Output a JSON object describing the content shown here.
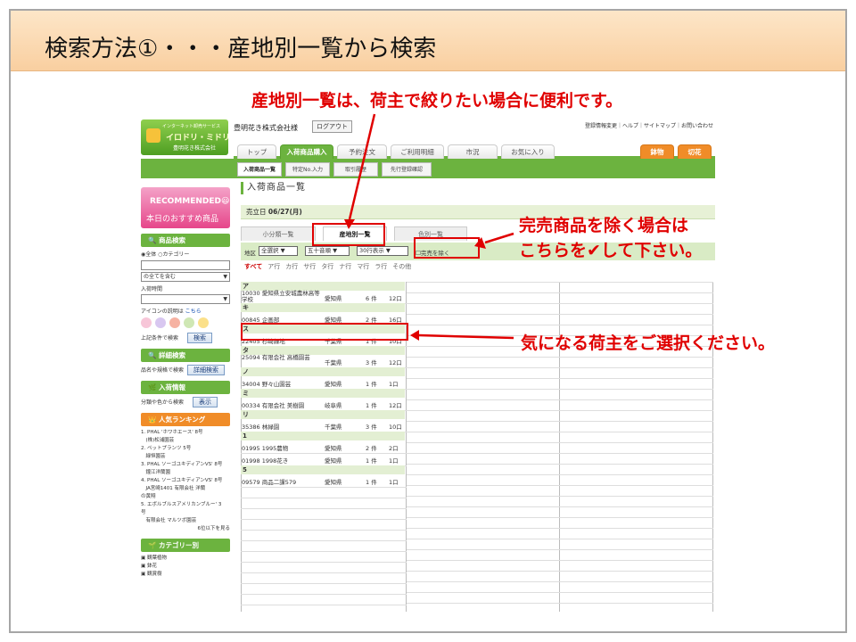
{
  "slide": {
    "title": "検索方法①・・・産地別一覧から検索"
  },
  "annotations": {
    "top_note": "産地別一覧は、荷主で絞りたい場合に便利です。",
    "soldout_note_line1": "完売商品を除く場合は",
    "soldout_note_line2": "こちらを✔して下さい。",
    "shipper_note": "気になる荷主をご選択ください。",
    "color_red": "#e00000"
  },
  "site": {
    "logo": {
      "line1": "インターネット卸売サービス",
      "line2": "イロドリ・ミドリ",
      "line3": "豊明花き株式会社"
    },
    "company_user": "豊明花き株式会社様",
    "logout": "ログアウト",
    "util_links": "登録情報変更｜ヘルプ｜サイトマップ｜お問い合わせ",
    "nav_tabs": [
      {
        "label": "トップ"
      },
      {
        "label": "入荷商品購入",
        "active": true
      },
      {
        "label": "予約注文"
      },
      {
        "label": "ご利用明細"
      },
      {
        "label": "市況"
      },
      {
        "label": "お気に入り"
      },
      {
        "label": "鉢物",
        "orange": true
      },
      {
        "label": "切花",
        "orange": true
      }
    ],
    "sub_tabs": [
      {
        "label": "入荷商品一覧",
        "active": true
      },
      {
        "label": "特定No.入力"
      },
      {
        "label": "取引履歴"
      },
      {
        "label": "先行登録確認"
      }
    ],
    "brand_green": "#6cb33f",
    "brand_orange": "#f08c28"
  },
  "sidebar": {
    "recommend_title": "RECOMMENDED😃",
    "recommend_sub": "本日のおすすめ商品",
    "product_search": {
      "heading": "商品検索",
      "radio_all": "全体",
      "radio_category": "カテゴリー",
      "contains_select": "の全てを含む",
      "time_label": "入荷時間",
      "icon_help_label": "アイコンの説明は",
      "icon_help_link": "こちら",
      "search_hint": "上記条件で検索",
      "search_button": "検索"
    },
    "detail_search": {
      "heading": "詳細検索",
      "hint": "品名や規格で検索",
      "button": "詳細検索"
    },
    "arrival_info": {
      "heading": "入荷情報",
      "hint": "分類や色から検索",
      "button": "表示"
    },
    "ranking": {
      "heading": "人気ランキング",
      "items": [
        "1. PHAL 'ホワホエース' 8号",
        "　(株)松浦園芸",
        "2. ペットプランツ 5号",
        "　緑恒園芸",
        "3. PHAL ソーゴユキディアンVS' 8号",
        "　鐘江洋蘭園",
        "4. PHAL ソーゴユキディアンVS' 8号",
        "　JA宮崎1401 有限会社 洋蘭",
        "の黄翔",
        "5. エボルブルスアメリカンブルー' 3",
        "号",
        "　有限会社 マルツボ園芸"
      ],
      "more": "6位以下を見る"
    },
    "category": {
      "heading": "カテゴリー別",
      "items": [
        "観葉植物",
        "鉢花",
        "観賞樹"
      ]
    }
  },
  "main": {
    "title": "入荷商品一覧",
    "sale_date_label": "売立日",
    "sale_date": "06/27(月)",
    "view_tabs": [
      {
        "label": "小分類一覧"
      },
      {
        "label": "産地別一覧",
        "active": true
      },
      {
        "label": "色別一覧"
      }
    ],
    "filter": {
      "region_label": "地区",
      "region_value": "全選択",
      "sort_value": "五十音順",
      "rows_value": "30行表示",
      "soldout_label": "完売を除く"
    },
    "kana": [
      "すべて",
      "ア行",
      "カ行",
      "サ行",
      "タ行",
      "ナ行",
      "マ行",
      "ラ行",
      "その他"
    ],
    "groups": [
      {
        "head": "ア",
        "items": [
          {
            "code": "10030 愛知県立安城農林高等学校",
            "pref": "愛知県",
            "count": "6 件",
            "num": "12口",
            "two": true
          }
        ]
      },
      {
        "head": "キ",
        "items": [
          {
            "code": "00845 企画部",
            "pref": "愛知県",
            "count": "2 件",
            "num": "16口"
          }
        ]
      },
      {
        "head": "ス",
        "items": [
          {
            "code": "22405 杉崎緑地",
            "pref": "千葉県",
            "count": "1 件",
            "num": "10口"
          }
        ]
      },
      {
        "head": "タ",
        "items": [
          {
            "code": "25094 有限会社 高橋園芸",
            "pref": "千葉県",
            "count": "3 件",
            "num": "12口",
            "two": true
          }
        ]
      },
      {
        "head": "ノ",
        "items": [
          {
            "code": "34004 野々山園芸",
            "pref": "愛知県",
            "count": "1 件",
            "num": "1口"
          }
        ]
      },
      {
        "head": "ミ",
        "items": [
          {
            "code": "00334 有限会社 美樹園",
            "pref": "岐阜県",
            "count": "1 件",
            "num": "12口"
          }
        ]
      },
      {
        "head": "リ",
        "items": [
          {
            "code": "35386 林緑園",
            "pref": "千葉県",
            "count": "3 件",
            "num": "10口"
          }
        ]
      },
      {
        "head": "1",
        "items": [
          {
            "code": "01995 1995農物",
            "pref": "愛知県",
            "count": "2 件",
            "num": "2口"
          },
          {
            "code": "01998 1998花き",
            "pref": "愛知県",
            "count": "1 件",
            "num": "1口"
          }
        ]
      },
      {
        "head": "5",
        "items": [
          {
            "code": "09579 商品二課579",
            "pref": "愛知県",
            "count": "1 件",
            "num": "1口"
          }
        ]
      }
    ]
  }
}
